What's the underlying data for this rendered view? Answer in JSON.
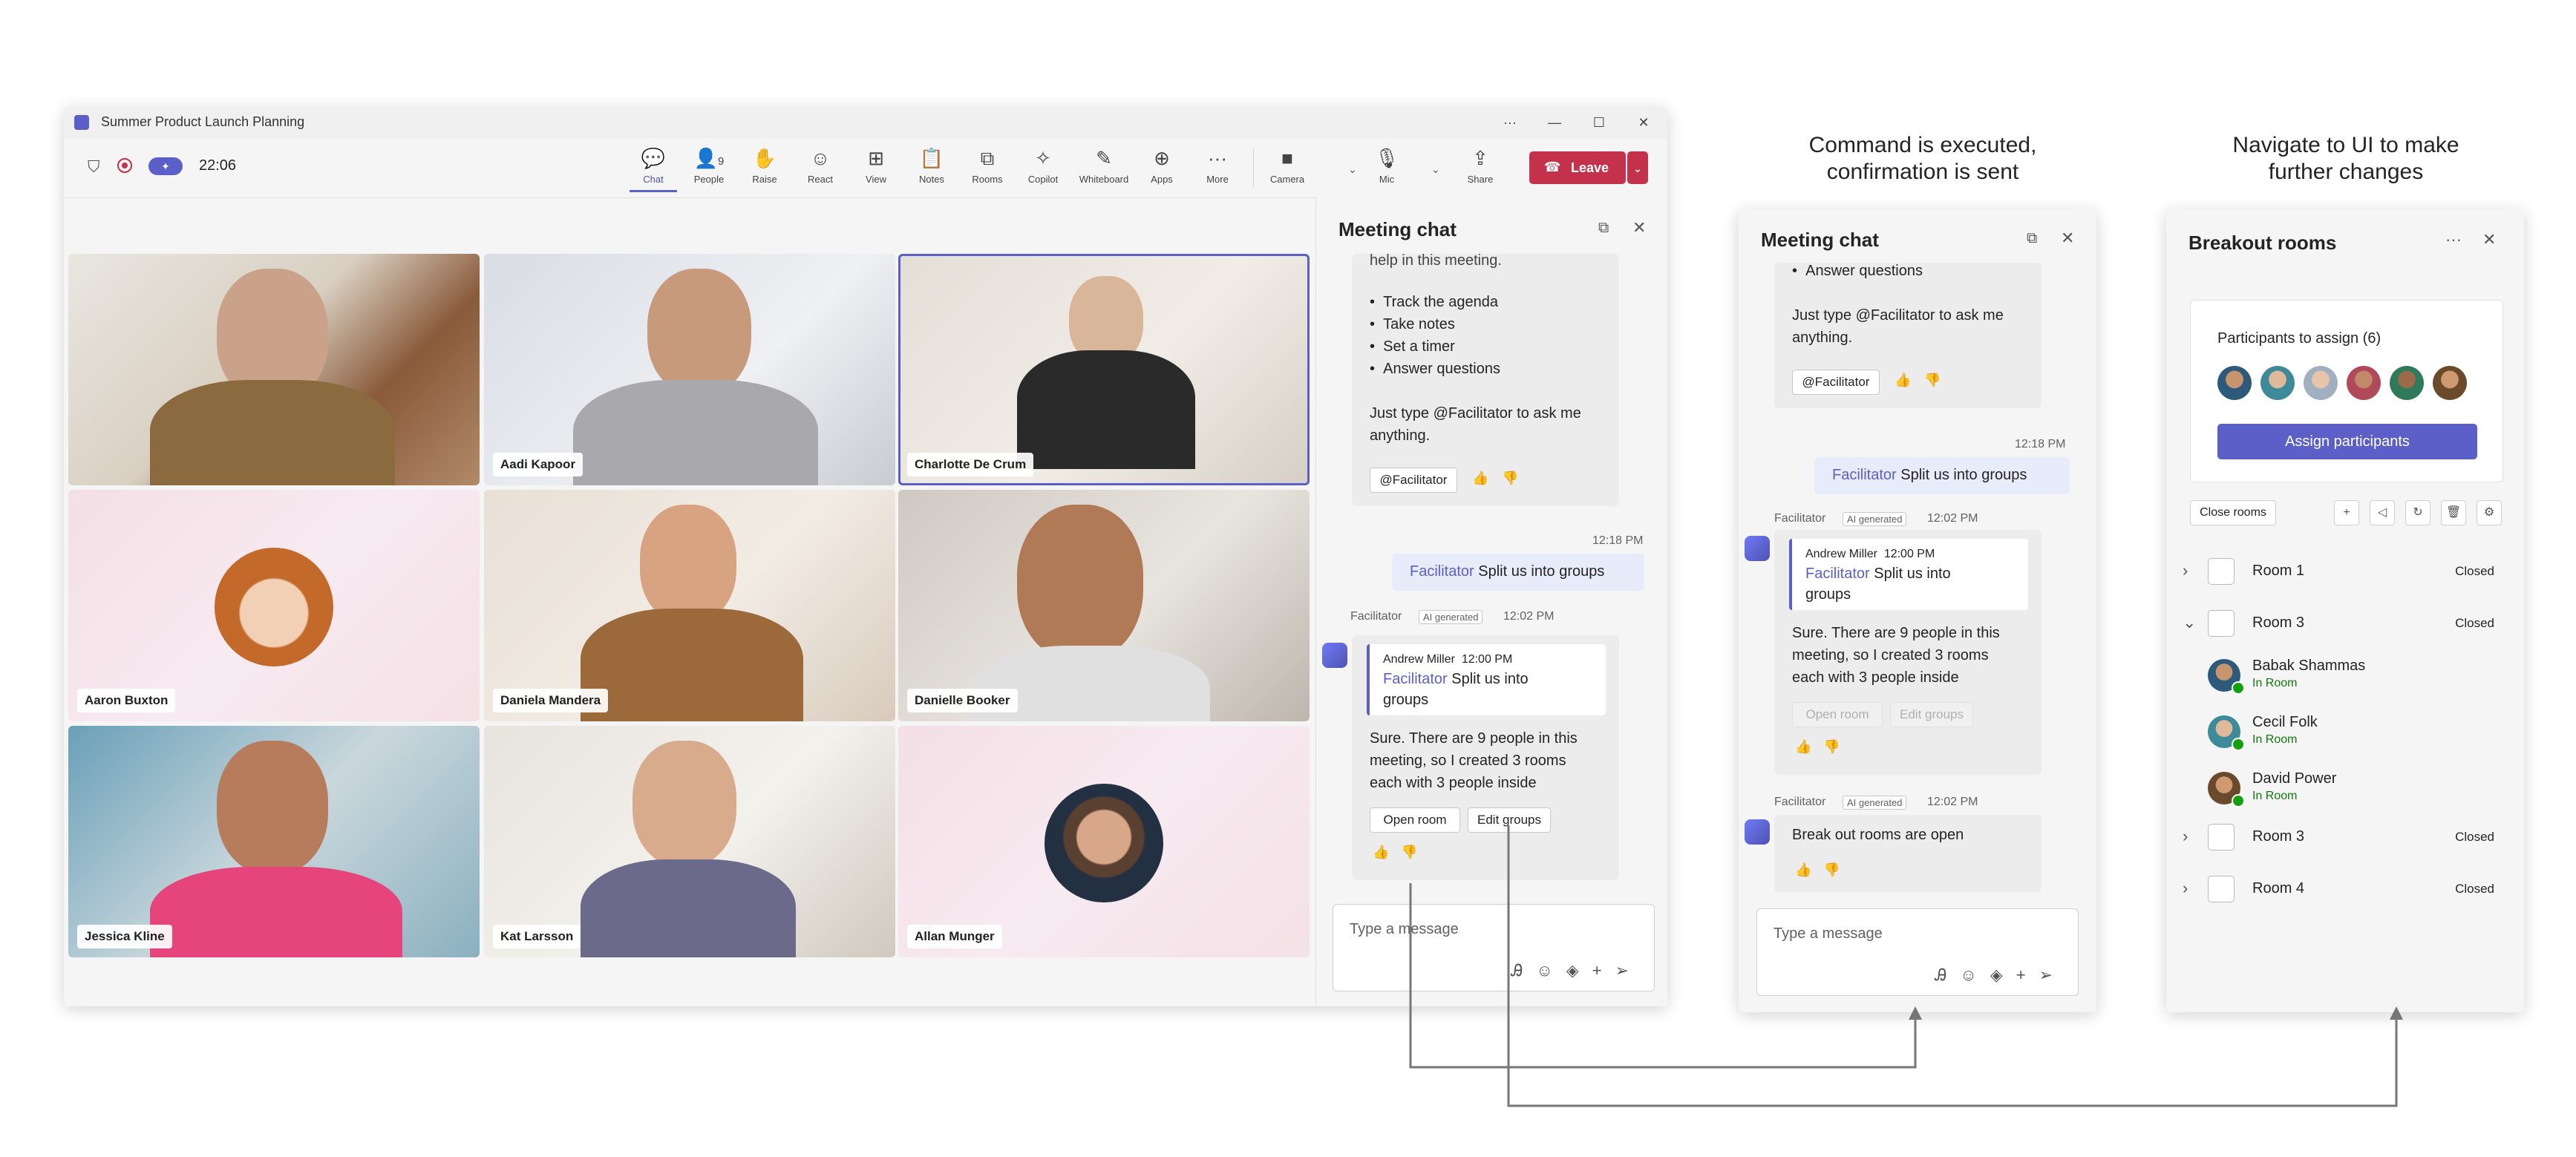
{
  "window": {
    "title": "Summer Product Launch Planning",
    "timer": "22:06",
    "title_controls": [
      "···",
      "—",
      "☐",
      "✕"
    ]
  },
  "toolbar": {
    "items": [
      {
        "label": "Chat",
        "icon": "chat-icon",
        "glyph": "💬"
      },
      {
        "label": "People",
        "icon": "people-icon",
        "glyph": "👤",
        "count": "9"
      },
      {
        "label": "Raise",
        "icon": "raise-hand-icon",
        "glyph": "✋"
      },
      {
        "label": "React",
        "icon": "react-icon",
        "glyph": "☺"
      },
      {
        "label": "View",
        "icon": "view-icon",
        "glyph": "⊞"
      },
      {
        "label": "Notes",
        "icon": "notes-icon",
        "glyph": "📋"
      },
      {
        "label": "Rooms",
        "icon": "rooms-icon",
        "glyph": "⧉"
      },
      {
        "label": "Copilot",
        "icon": "copilot-icon",
        "glyph": "✧"
      },
      {
        "label": "Whiteboard",
        "icon": "whiteboard-icon",
        "glyph": "✎"
      },
      {
        "label": "Apps",
        "icon": "apps-icon",
        "glyph": "⊕"
      },
      {
        "label": "More",
        "icon": "more-icon",
        "glyph": "···"
      }
    ],
    "camera_label": "Camera",
    "mic_label": "Mic",
    "share_label": "Share",
    "leave_label": "Leave"
  },
  "participants": [
    {
      "name": ""
    },
    {
      "name": "Aadi Kapoor"
    },
    {
      "name": "Charlotte De Crum"
    },
    {
      "name": "Aaron Buxton"
    },
    {
      "name": "Daniela Mandera"
    },
    {
      "name": "Danielle Booker"
    },
    {
      "name": "Jessica Kline"
    },
    {
      "name": "Kat Larsson"
    },
    {
      "name": "Allan Munger"
    }
  ],
  "chat1": {
    "title": "Meeting chat",
    "intro_partial": "help in this meeting.",
    "bullets": [
      "Track the agenda",
      "Take notes",
      "Set a timer",
      "Answer questions"
    ],
    "instruction_1": "Just type @Facilitator to ask me",
    "instruction_2": "anything.",
    "facilitator_chip": "@Facilitator",
    "my_time": "12:18 PM",
    "my_message_mention": "Facilitator",
    "my_message_text": " Split us into groups",
    "bot_name": "Facilitator",
    "ai_tag": "AI generated",
    "bot_time": "12:02 PM",
    "quote_author": "Andrew Miller",
    "quote_time": "12:00 PM",
    "quote_mention": "Facilitator",
    "quote_text_1": " Split us into",
    "quote_text_2": "groups",
    "reply_1": "Sure. There are 9 people in this",
    "reply_2": "meeting, so I created 3 rooms",
    "reply_3": "each with 3 people inside",
    "btn_open": "Open room",
    "btn_edit": "Edit groups",
    "compose_placeholder": "Type a message"
  },
  "caption1": {
    "line1": "Command is executed,",
    "line2": "confirmation is sent"
  },
  "chat2": {
    "title": "Meeting chat",
    "bullet_partial": "Answer questions",
    "instruction_1": "Just type @Facilitator to ask me",
    "instruction_2": "anything.",
    "facilitator_chip": "@Facilitator",
    "my_time": "12:18 PM",
    "my_message_mention": "Facilitator",
    "my_message_text": " Split us into groups",
    "bot_name": "Facilitator",
    "ai_tag": "AI generated",
    "bot_time": "12:02 PM",
    "quote_author": "Andrew Miller",
    "quote_time": "12:00 PM",
    "quote_mention": "Facilitator",
    "quote_text_1": " Split us into",
    "quote_text_2": "groups",
    "reply_1": "Sure. There are 9 people in this",
    "reply_2": "meeting, so I created 3 rooms",
    "reply_3": "each with 3 people inside",
    "btn_open": "Open room",
    "btn_edit": "Edit groups",
    "bot2_name": "Facilitator",
    "bot2_tag": "AI generated",
    "bot2_time": "12:02 PM",
    "bot2_text": "Break out rooms are open",
    "compose_placeholder": "Type a message"
  },
  "caption2": {
    "line1": "Navigate to UI to make",
    "line2": "further changes"
  },
  "breakout": {
    "title": "Breakout rooms",
    "assign_header": "Participants to assign (6)",
    "assign_button": "Assign participants",
    "close_rooms": "Close rooms",
    "rooms": [
      {
        "name": "Room 1",
        "status": "Closed",
        "expanded": false
      },
      {
        "name": "Room 3",
        "status": "Closed",
        "expanded": true
      },
      {
        "name": "Room 3",
        "status": "Closed",
        "expanded": false
      },
      {
        "name": "Room 4",
        "status": "Closed",
        "expanded": false
      }
    ],
    "members": [
      {
        "name": "Babak Shammas",
        "status": "In Room"
      },
      {
        "name": "Cecil Folk",
        "status": "In Room"
      },
      {
        "name": "David Power",
        "status": "In Room"
      }
    ]
  },
  "colors": {
    "accent": "#5b5fc7",
    "leave": "#c4314b",
    "in_room": "#0e7a0d",
    "my_bubble": "#e8ebfa"
  }
}
